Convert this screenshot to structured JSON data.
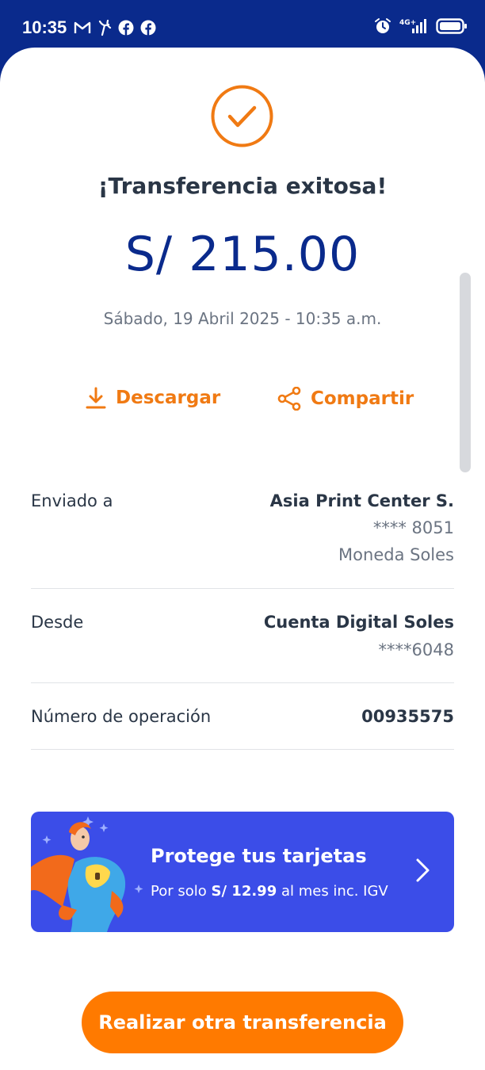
{
  "status_bar": {
    "time": "10:35",
    "left_icons": [
      "gmail-icon",
      "yape-icon",
      "facebook-icon",
      "facebook-icon"
    ],
    "right_icons": [
      "alarm-icon",
      "signal-4g-icon",
      "battery-icon"
    ],
    "network": "4G+"
  },
  "receipt": {
    "title": "¡Transferencia exitosa!",
    "amount": "S/ 215.00",
    "date": "Sábado, 19 Abril 2025 - 10:35 a.m."
  },
  "actions": {
    "download_label": "Descargar",
    "share_label": "Compartir"
  },
  "details": {
    "sent_to": {
      "label": "Enviado a",
      "name": "Asia Print Center S.",
      "account": "**** 8051",
      "currency": "Moneda Soles"
    },
    "from": {
      "label": "Desde",
      "account_name": "Cuenta Digital Soles",
      "account": "****6048"
    },
    "operation": {
      "label": "Número de operación",
      "number": "00935575"
    }
  },
  "promo": {
    "title": "Protege tus tarjetas",
    "sub_prefix": "Por solo ",
    "sub_price": "S/ 12.99",
    "sub_suffix": " al mes inc. IGV"
  },
  "cta": {
    "label": "Realizar otra transferencia"
  },
  "colors": {
    "brand_blue": "#0a2a8c",
    "accent_orange": "#f07a13",
    "promo_blue": "#3b4de8",
    "cta_orange": "#ff7a00"
  }
}
